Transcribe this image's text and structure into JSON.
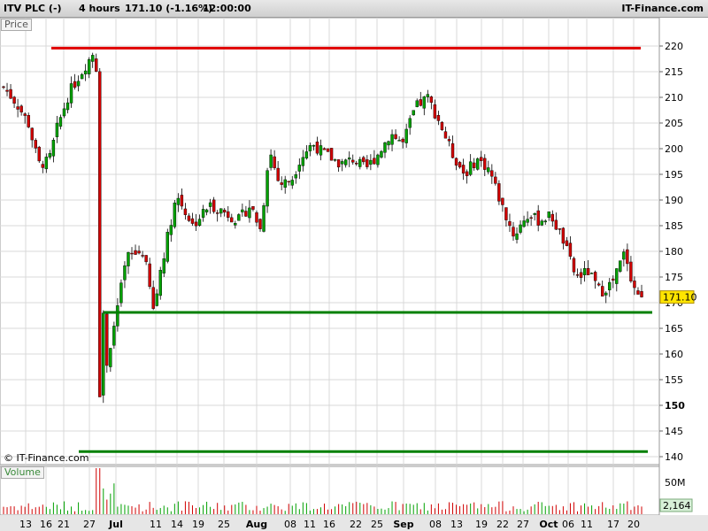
{
  "header": {
    "symbol": "ITV PLC (-)",
    "timeframe": "4 hours",
    "last_change": "171.10 (-1.16%)",
    "time": "12:00:00",
    "brand": "IT-Finance.com"
  },
  "panels": {
    "price_label": "Price",
    "volume_label": "Volume",
    "copyright": "© IT-Finance.com",
    "price_tag": "171.10",
    "volume_tag": "2,164",
    "volume_tick": "50M"
  },
  "colors": {
    "up": "#00a000",
    "down": "#d00000",
    "resistance": "#e00000",
    "support": "#008000",
    "grid": "#d8d8d8",
    "price_tag_bg": "#ffe400",
    "volume_tag_bg": "#d8f0d8"
  },
  "chart_data": [
    {
      "type": "candlestick",
      "title": "ITV PLC (-)",
      "ylabel": "Price",
      "ylim": [
        138,
        223
      ],
      "ytick_labels": [
        "140",
        "145",
        "150",
        "155",
        "160",
        "165",
        "170",
        "175",
        "180",
        "185",
        "190",
        "195",
        "200",
        "205",
        "210",
        "215",
        "220"
      ],
      "xtick_labels": [
        "13",
        "16",
        "21",
        "27",
        "Jul",
        "11",
        "14",
        "19",
        "25",
        "Aug",
        "08",
        "11",
        "16",
        "22",
        "25",
        "Sep",
        "08",
        "13",
        "19",
        "22",
        "27",
        "Oct",
        "06",
        "11",
        "17",
        "20"
      ],
      "last_price": 171.1,
      "close_path": [
        {
          "t": 0,
          "c": 212
        },
        {
          "t": 0.03,
          "c": 209
        },
        {
          "t": 0.06,
          "c": 205
        },
        {
          "t": 0.085,
          "c": 197
        },
        {
          "t": 0.11,
          "c": 197.5
        },
        {
          "t": 0.13,
          "c": 204
        },
        {
          "t": 0.16,
          "c": 211
        },
        {
          "t": 0.22,
          "c": 219
        },
        {
          "t": 0.228,
          "c": 214
        },
        {
          "t": 0.232,
          "c": 142
        },
        {
          "t": 0.238,
          "c": 177
        },
        {
          "t": 0.248,
          "c": 157
        },
        {
          "t": 0.27,
          "c": 166
        },
        {
          "t": 0.3,
          "c": 179
        },
        {
          "t": 0.34,
          "c": 180
        },
        {
          "t": 0.365,
          "c": 168
        },
        {
          "t": 0.38,
          "c": 176
        },
        {
          "t": 0.42,
          "c": 191
        },
        {
          "t": 0.46,
          "c": 185
        },
        {
          "t": 0.5,
          "c": 189
        },
        {
          "t": 0.53,
          "c": 188
        },
        {
          "t": 0.57,
          "c": 186
        },
        {
          "t": 0.6,
          "c": 189
        },
        {
          "t": 0.625,
          "c": 184
        },
        {
          "t": 0.645,
          "c": 200
        },
        {
          "t": 0.67,
          "c": 193
        },
        {
          "t": 0.7,
          "c": 194
        },
        {
          "t": 0.72,
          "c": 198
        },
        {
          "t": 0.75,
          "c": 201
        },
        {
          "t": 0.78,
          "c": 199
        },
        {
          "t": 0.82,
          "c": 197
        },
        {
          "t": 0.85,
          "c": 198
        },
        {
          "t": 0.88,
          "c": 196
        },
        {
          "t": 0.91,
          "c": 199
        },
        {
          "t": 0.94,
          "c": 203
        },
        {
          "t": 0.97,
          "c": 201
        },
        {
          "t": 1.0,
          "c": 208
        },
        {
          "t": 1.03,
          "c": 210
        },
        {
          "t": 1.06,
          "c": 205
        },
        {
          "t": 1.09,
          "c": 199
        },
        {
          "t": 1.12,
          "c": 195
        },
        {
          "t": 1.15,
          "c": 198
        },
        {
          "t": 1.18,
          "c": 196
        },
        {
          "t": 1.21,
          "c": 189
        },
        {
          "t": 1.24,
          "c": 183
        },
        {
          "t": 1.27,
          "c": 187
        },
        {
          "t": 1.3,
          "c": 186
        },
        {
          "t": 1.33,
          "c": 187
        },
        {
          "t": 1.36,
          "c": 182
        },
        {
          "t": 1.39,
          "c": 175
        },
        {
          "t": 1.42,
          "c": 176
        },
        {
          "t": 1.45,
          "c": 172
        },
        {
          "t": 1.48,
          "c": 174
        },
        {
          "t": 1.51,
          "c": 180
        },
        {
          "t": 1.53,
          "c": 173
        },
        {
          "t": 1.55,
          "c": 171.1
        }
      ],
      "horizontal_lines": [
        {
          "name": "resistance",
          "price": 219.6,
          "from": "21",
          "to": "20"
        },
        {
          "name": "support-upper",
          "price": 168.1,
          "from": "Jul",
          "to": "20"
        },
        {
          "name": "support-lower",
          "price": 141.0,
          "from": "27",
          "to": "20"
        }
      ]
    },
    {
      "type": "bar",
      "title": "Volume",
      "ytick_labels": [
        "50M"
      ],
      "last_value": "2,164"
    }
  ]
}
